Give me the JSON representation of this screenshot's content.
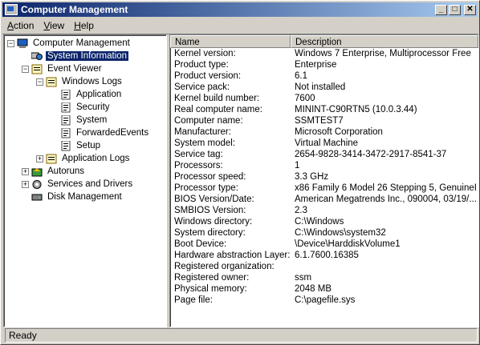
{
  "window": {
    "title": "Computer Management",
    "controls": {
      "minimize": "_",
      "maximize": "□",
      "close": "✕"
    }
  },
  "menu": [
    {
      "label": "Action",
      "accel": "A",
      "rest": "ction"
    },
    {
      "label": "View",
      "accel": "V",
      "rest": "iew"
    },
    {
      "label": "Help",
      "accel": "H",
      "rest": "elp"
    }
  ],
  "tree": [
    {
      "id": "computer-management",
      "label": "Computer Management",
      "level": 0,
      "expander": "−",
      "icon": "computer-icon"
    },
    {
      "id": "system-information",
      "label": "System Information",
      "level": 1,
      "expander": "",
      "icon": "system-info-icon",
      "selected": true
    },
    {
      "id": "event-viewer",
      "label": "Event Viewer",
      "level": 1,
      "expander": "−",
      "icon": "event-viewer-icon"
    },
    {
      "id": "windows-logs",
      "label": "Windows Logs",
      "level": 2,
      "expander": "−",
      "icon": "folder-icon"
    },
    {
      "id": "application",
      "label": "Application",
      "level": 3,
      "expander": "",
      "icon": "log-icon"
    },
    {
      "id": "security",
      "label": "Security",
      "level": 3,
      "expander": "",
      "icon": "log-icon"
    },
    {
      "id": "system",
      "label": "System",
      "level": 3,
      "expander": "",
      "icon": "log-icon"
    },
    {
      "id": "forwarded-events",
      "label": "ForwardedEvents",
      "level": 3,
      "expander": "",
      "icon": "log-icon"
    },
    {
      "id": "setup",
      "label": "Setup",
      "level": 3,
      "expander": "",
      "icon": "log-icon"
    },
    {
      "id": "application-logs",
      "label": "Application Logs",
      "level": 2,
      "expander": "+",
      "icon": "folder-icon"
    },
    {
      "id": "autoruns",
      "label": "Autoruns",
      "level": 1,
      "expander": "+",
      "icon": "autoruns-icon"
    },
    {
      "id": "services-and-drivers",
      "label": "Services and Drivers",
      "level": 1,
      "expander": "+",
      "icon": "services-icon"
    },
    {
      "id": "disk-management",
      "label": "Disk Management",
      "level": 1,
      "expander": "",
      "icon": "disk-icon"
    }
  ],
  "list": {
    "columns": [
      "Name",
      "Description"
    ],
    "rows": [
      [
        "Kernel version:",
        "Windows 7 Enterprise, Multiprocessor Free"
      ],
      [
        "Product type:",
        "Enterprise"
      ],
      [
        "Product version:",
        "6.1"
      ],
      [
        "Service pack:",
        "Not installed"
      ],
      [
        "Kernel build number:",
        "7600"
      ],
      [
        "Real computer name:",
        "MININT-C90RTN5 (10.0.3.44)"
      ],
      [
        "Computer name:",
        "SSMTEST7"
      ],
      [
        "Manufacturer:",
        "Microsoft Corporation"
      ],
      [
        "System model:",
        "Virtual Machine"
      ],
      [
        "Service tag:",
        "2654-9828-3414-3472-2917-8541-37"
      ],
      [
        "Processors:",
        "1"
      ],
      [
        "Processor speed:",
        "3.3 GHz"
      ],
      [
        "Processor type:",
        "x86 Family 6 Model 26 Stepping 5, GenuineI..."
      ],
      [
        "BIOS Version/Date:",
        "American Megatrends Inc., 090004, 03/19/..."
      ],
      [
        "SMBIOS Version:",
        "2.3"
      ],
      [
        "Windows directory:",
        "C:\\Windows"
      ],
      [
        "System directory:",
        "C:\\Windows\\system32"
      ],
      [
        "Boot Device:",
        "\\Device\\HarddiskVolume1"
      ],
      [
        "Hardware abstraction Layer:",
        "6.1.7600.16385"
      ],
      [
        "Registered organization:",
        ""
      ],
      [
        "Registered owner:",
        "ssm"
      ],
      [
        "Physical memory:",
        "2048 MB"
      ],
      [
        "Page file:",
        "C:\\pagefile.sys"
      ]
    ]
  },
  "status": {
    "text": "Ready"
  },
  "colors": {
    "titlebar_start": "#0a246a",
    "titlebar_end": "#a6caf0",
    "selection": "#0a246a",
    "face": "#d4d0c8"
  }
}
